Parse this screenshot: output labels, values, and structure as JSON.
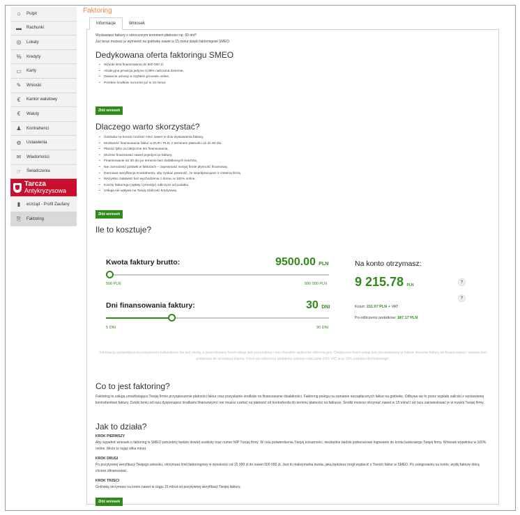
{
  "sidebar": {
    "items": [
      {
        "label": "Pulpit",
        "icon": "home-icon"
      },
      {
        "label": "Rachunki",
        "icon": "wallet-icon"
      },
      {
        "label": "Lokaty",
        "icon": "coins-icon"
      },
      {
        "label": "Kredyty",
        "icon": "percent-icon"
      },
      {
        "label": "Karty",
        "icon": "cards-icon"
      },
      {
        "label": "Wnioski",
        "icon": "document-icon"
      },
      {
        "label": "Kantor walutowy",
        "icon": "euro-icon"
      },
      {
        "label": "Waluty",
        "icon": "euro-icon"
      },
      {
        "label": "Kontrahenci",
        "icon": "users-icon"
      },
      {
        "label": "Ustawienia",
        "icon": "gear-icon"
      },
      {
        "label": "Wiadomości",
        "icon": "mail-icon"
      },
      {
        "label": "Świadczenia",
        "icon": "hand-icon"
      }
    ],
    "banner": {
      "line1": "Tarcza",
      "line2": "Antykryzysowa"
    },
    "bottom_items": [
      {
        "label": "eUrząd - Profil Zaufany",
        "icon": "phone-icon"
      },
      {
        "label": "Faktoring",
        "icon": "invoice-icon"
      }
    ]
  },
  "page": {
    "title": "Faktoring",
    "tabs": [
      {
        "label": "Informacje"
      },
      {
        "label": "Wniosek"
      }
    ],
    "intro": [
      "Wystawiasz faktury z odroczonym terminem płatności np. 60 dni?",
      "Już teraz możesz je wymienić na gotówkę nawet w 15 minut dzięki faktoringowi SMEO."
    ],
    "offer": {
      "heading": "Dedykowana oferta faktoringu SMEO",
      "bullets": [
        "Wysoki limit finansowania do 500 000 zł,",
        "Atrakcyjna prowizja jedynie 0,08% naliczana dziennie,",
        "Zawarcie umowy w szybkim procesie online,",
        "Przelew środków na konto już w 15 minut."
      ],
      "button": "Złóż wniosek"
    },
    "why": {
      "heading": "Dlaczego warto skorzystać?",
      "bullets": [
        "Gotówka na koncie możesz mieć nawet w dniu wystawienia faktury,",
        "Możliwość finansowania faktur w EUR i PLN, z terminem płatności aż do 90 dni,",
        "Płacisz tylko za faktyczne dni finansowania,",
        "Możesz finansować nawet pojedyncze faktury,",
        "Finansowanie do 30 dni po terminie bez dodatkowych kosztów,",
        "Nie zamrażasz gotówki w fakturach – zapewniasz swojej firmie płynność finansową,",
        "Darmowa weryfikacja Kontrahenta, aby zyskać pewność, że współpracujesz z rzetelną firmą",
        "Wszystko załatwisz bez wychodzenia z domu, w 100% online,",
        "Koszty faktoringu (opłaty i prowizje) odliczysz od podatku,",
        "Usługa nie wpływa na Twoją zdolność kredytową."
      ],
      "button": "Złóż wniosek"
    },
    "cost": {
      "heading": "Ile to kosztuje?",
      "amount_label": "Kwota faktury brutto:",
      "amount_value": "9500.00",
      "amount_unit": "PLN",
      "amount_min": "500 PLN",
      "amount_max": "500 000 PLN",
      "amount_slider_fraction": 0.018,
      "days_label": "Dni finansowania faktury:",
      "days_value": "30",
      "days_unit": "DNI",
      "days_min": "5 DNI",
      "days_max": "90 DNI",
      "days_slider_fraction": 0.294,
      "receive_label": "Na konto otrzymasz:",
      "receive_value": "9 215.78",
      "receive_unit": "PLN",
      "cost_label": "Koszt:",
      "cost_value": "231.07 PLN",
      "cost_suffix": "+ VAT",
      "tax_label": "Po odliczeniu podatków:",
      "tax_value": "187.17 PLN",
      "help_symbol": "?",
      "disclaimer": "Informacja wyświetlona na powyższym kalkulatorze nie jest ofertą, a prezentowany koszt usługi jest szacunkowy i ma charakter wyłącznie informacyjny. Ostateczny koszt usługi jest prezentowany w trakcie zlecenia faktury do finansowania i zawsze jest podawany do akceptacji klienta. Koszt po odliczeniu podatków zakłada odliczenie 23% VAT oraz 19% podatku dochodowego."
    },
    "what": {
      "heading": "Co to jest faktoring?",
      "text": "Faktoring to usługa umożliwiająca Twojej firmie przyspieszenie płatności faktur oraz pozyskanie środków na finansowanie działalności. Faktoring polega na zamianie niezapłaconych faktur na gotówkę. Odbywa się to przez wypłatę zaliczki z wystawionej kontrahentowi faktury. Dzięki temu od razu dysponujesz środkami finansowymi i nie musisz czekać na płatność od kontrahenta do terminu płatności na fakturze. Środki możesz otrzymać nawet w 15 minut i od razu zainwestować je w rozwój Twojej firmy."
    },
    "how": {
      "heading": "Jak to działa?",
      "steps": [
        {
          "title": "KROK PIERWSZY",
          "text": "Aby wypełnić wniosek o faktoring w SMEO potrzebny będzie dowód osobisty oraz numer NIP Twojej firmy. W celu potwierdzenia Twojej tożsamości, niezbędne będzie jednorazowe logowanie do konta bankowego Twojej firmy. Wniosek wypełnisz w 100% online. Może to zająć kilka minut."
        },
        {
          "title": "KROK DRUGI",
          "text": "Po pozytywnej weryfikacji Twojego wniosku, otrzymasz limit faktoringowy w wysokości od 15 000 zł do nawet 500 000 zł. Jest to maksymalna kwota, jaką będziesz mógł wypłacić z Twoich faktur w SMEO. Po zalogowaniu na konto, wyślij fakturę którą chcesz sfinansować."
        },
        {
          "title": "KROK TRZECI",
          "text": "Gotówkę otrzymasz na konto nawet w ciągu 15 minut od pozytywnej weryfikacji Twojej faktury."
        }
      ],
      "button": "Złóż wniosek"
    }
  }
}
